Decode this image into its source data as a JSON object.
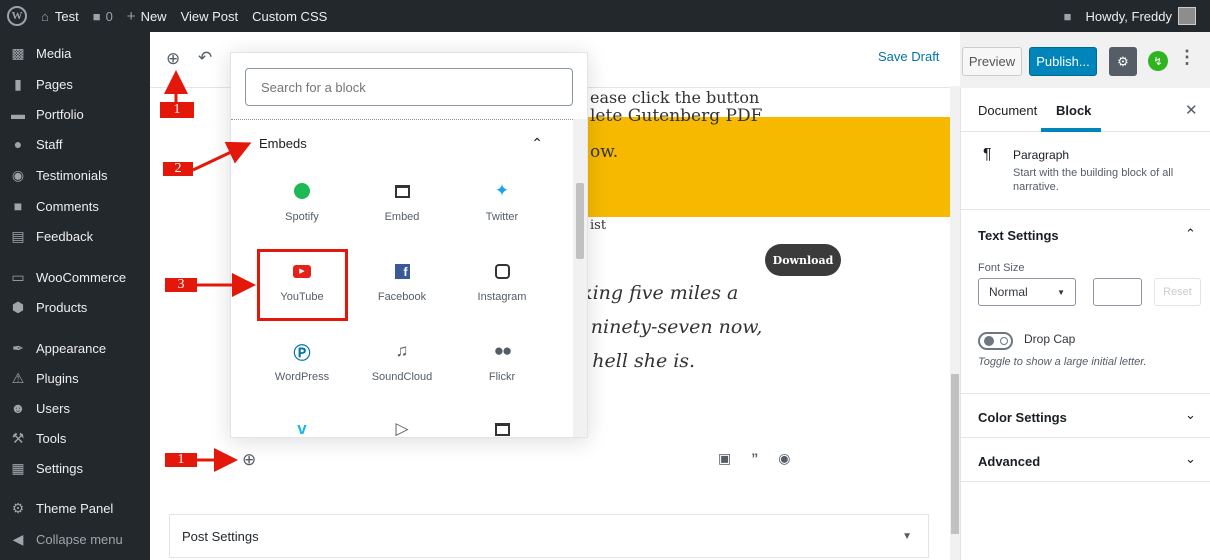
{
  "adminbar": {
    "site_name": "Test",
    "comments_count": "0",
    "new_label": "New",
    "view_post": "View Post",
    "custom_css": "Custom CSS",
    "howdy": "Howdy, Freddy"
  },
  "sidebar": {
    "items": [
      {
        "label": "Media",
        "icon": "media-icon"
      },
      {
        "label": "Pages",
        "icon": "pages-icon"
      },
      {
        "label": "Portfolio",
        "icon": "portfolio-icon"
      },
      {
        "label": "Staff",
        "icon": "staff-icon"
      },
      {
        "label": "Testimonials",
        "icon": "testimonials-icon"
      },
      {
        "label": "Comments",
        "icon": "comments-icon"
      },
      {
        "label": "Feedback",
        "icon": "feedback-icon"
      },
      {
        "label": "WooCommerce",
        "icon": "woocommerce-icon"
      },
      {
        "label": "Products",
        "icon": "products-icon"
      },
      {
        "label": "Appearance",
        "icon": "appearance-icon"
      },
      {
        "label": "Plugins",
        "icon": "plugins-icon"
      },
      {
        "label": "Users",
        "icon": "users-icon"
      },
      {
        "label": "Tools",
        "icon": "tools-icon"
      },
      {
        "label": "Settings",
        "icon": "settings-icon"
      },
      {
        "label": "Theme Panel",
        "icon": "theme-panel-icon"
      },
      {
        "label": "Collapse menu",
        "icon": "collapse-icon"
      }
    ]
  },
  "toolbar": {
    "save_draft": "Save Draft",
    "preview": "Preview",
    "publish": "Publish..."
  },
  "content": {
    "line1": "ease click the button",
    "line2": "lete Gutenberg PDF",
    "line3": "ow.",
    "list_fragment": "ist",
    "download": "Download",
    "quote1": "lking five miles a",
    "quote2": "s ninety-seven now,",
    "quote3": "e hell she is."
  },
  "inserter": {
    "search_placeholder": "Search for a block",
    "section": "Embeds",
    "blocks": [
      {
        "label": "Spotify",
        "icon": "spotify-icon"
      },
      {
        "label": "Embed",
        "icon": "embed-icon"
      },
      {
        "label": "Twitter",
        "icon": "twitter-icon"
      },
      {
        "label": "YouTube",
        "icon": "youtube-icon"
      },
      {
        "label": "Facebook",
        "icon": "facebook-icon"
      },
      {
        "label": "Instagram",
        "icon": "instagram-icon"
      },
      {
        "label": "WordPress",
        "icon": "wordpress-icon"
      },
      {
        "label": "SoundCloud",
        "icon": "soundcloud-icon"
      },
      {
        "label": "Flickr",
        "icon": "flickr-icon"
      }
    ]
  },
  "annotations": {
    "step1": "1",
    "step2": "2",
    "step3": "3",
    "color": "#e3170a"
  },
  "post_settings": "Post Settings",
  "panel": {
    "tab_document": "Document",
    "tab_block": "Block",
    "block_name": "Paragraph",
    "block_desc": "Start with the building block of all narrative.",
    "text_settings": "Text Settings",
    "font_size_label": "Font Size",
    "font_size_value": "Normal",
    "reset": "Reset",
    "drop_cap": "Drop Cap",
    "drop_cap_help": "Toggle to show a large initial letter.",
    "color_settings": "Color Settings",
    "advanced": "Advanced"
  },
  "colors": {
    "admin_bg": "#23282d",
    "accent": "#0085ba",
    "highlight_block": "#f6b900"
  }
}
